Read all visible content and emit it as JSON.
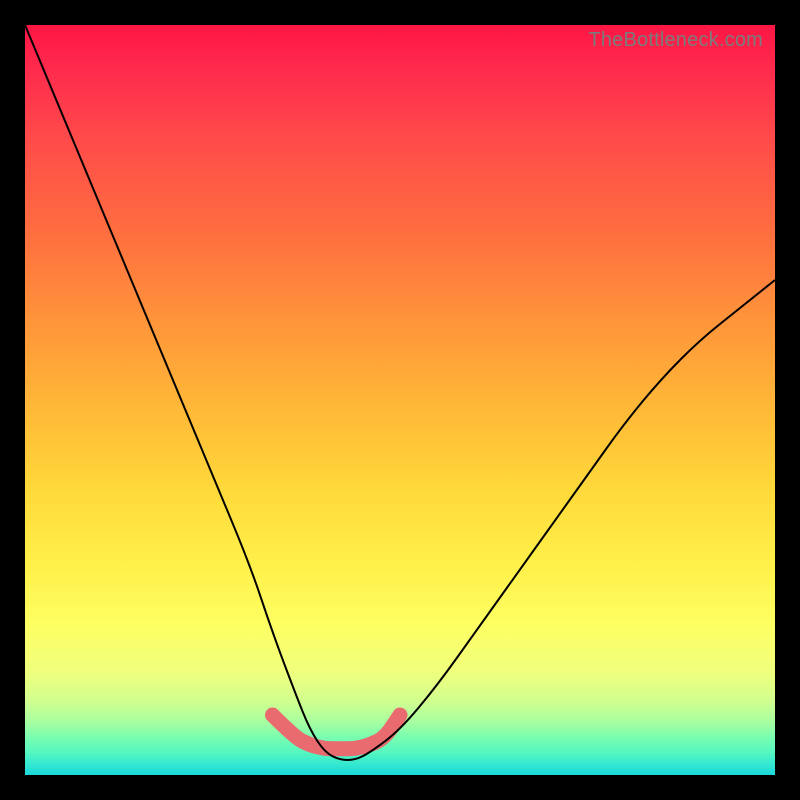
{
  "watermark": "TheBottleneck.com",
  "chart_data": {
    "type": "line",
    "title": "",
    "xlabel": "",
    "ylabel": "",
    "xlim": [
      0,
      100
    ],
    "ylim": [
      0,
      100
    ],
    "grid": false,
    "legend": false,
    "series": [
      {
        "name": "bottleneck-curve",
        "color": "#000000",
        "stroke_width": 2,
        "x": [
          0,
          5,
          10,
          15,
          20,
          25,
          30,
          33,
          36,
          38,
          40,
          42,
          44,
          46,
          50,
          55,
          60,
          65,
          70,
          75,
          80,
          85,
          90,
          95,
          100
        ],
        "y": [
          100,
          88,
          76,
          64,
          52,
          40,
          28,
          19,
          11,
          6,
          3,
          2,
          2,
          3,
          6,
          12,
          19,
          26,
          33,
          40,
          47,
          53,
          58,
          62,
          66
        ]
      },
      {
        "name": "sweet-spot-band",
        "color": "#e96a6f",
        "stroke_width": 15,
        "linecap": "round",
        "x": [
          33,
          36,
          38,
          40,
          42,
          44,
          46,
          48,
          50
        ],
        "y": [
          8,
          5,
          4,
          3.5,
          3.5,
          3.5,
          4,
          5,
          8
        ]
      }
    ],
    "gradient_stops": [
      {
        "pos": 0,
        "color": "#ff1644"
      },
      {
        "pos": 0.5,
        "color": "#ffbb37"
      },
      {
        "pos": 0.8,
        "color": "#feff62"
      },
      {
        "pos": 1.0,
        "color": "#1ad7da"
      }
    ]
  }
}
